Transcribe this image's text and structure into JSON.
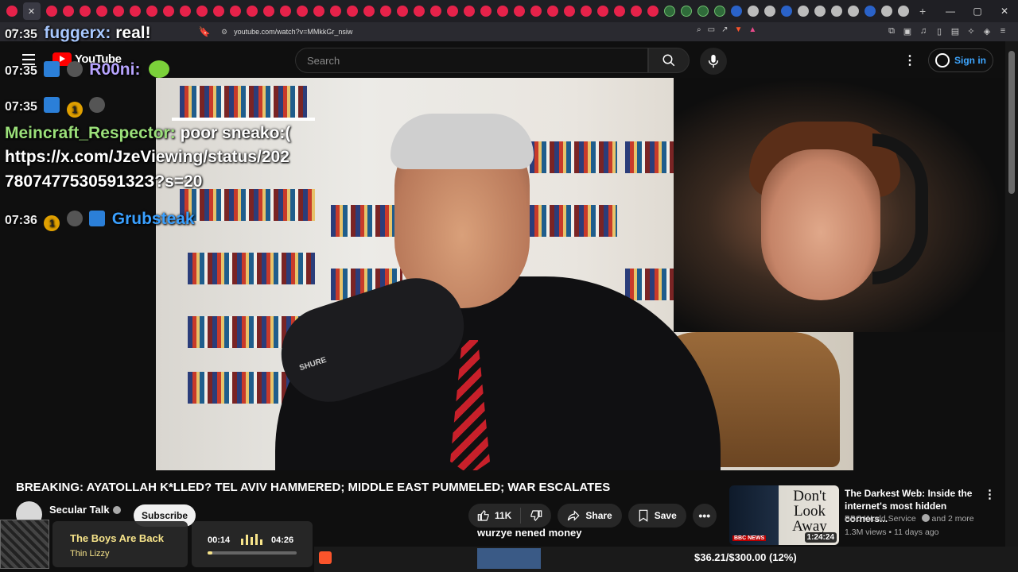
{
  "browser": {
    "url": "youtube.com/watch?v=MMkkGr_nsiw"
  },
  "youtube": {
    "logo_text": "YouTube",
    "search_placeholder": "Search",
    "signin_label": "Sign in"
  },
  "chat": [
    {
      "time": "07:35",
      "user": "fuggerx",
      "user_color": "#a8c8ff",
      "message": "real!"
    },
    {
      "time": "07:35",
      "user": "R00ni:",
      "user_color": "#b7a4ff",
      "message": ""
    },
    {
      "time": "07:35",
      "user": "",
      "user_color": "#fff",
      "message": ""
    },
    {
      "time": "",
      "user": "Meincraft_Respector",
      "user_color": "#9be07a",
      "message": "poor sneako:("
    },
    {
      "time": "",
      "user": "",
      "user_color": "#fff",
      "message": "https://x.com/JzeViewing/status/202"
    },
    {
      "time": "",
      "user": "",
      "user_color": "#fff",
      "message": "780747753059132З?s=20"
    },
    {
      "time": "07:36",
      "user": "Grubsteak",
      "user_color": "#3aa0ff",
      "message": ""
    }
  ],
  "video": {
    "title": "BREAKING: AYATOLLAH K*LLED? TEL AVIV HAMMERED; MIDDLE EAST PUMMELED; WAR ESCALATES",
    "mic_brand": "SHURE",
    "channel": "Secular Talk",
    "subscribe_label": "Subscribe",
    "likes": "11K",
    "share_label": "Share",
    "save_label": "Save"
  },
  "recommendation": {
    "thumb_text": "Don't Look Away",
    "thumb_badge": "BBC NEWS",
    "duration": "1:24:24",
    "title": "The Darkest Web: Inside the internet's most hidden corners...",
    "channel": "BBC World Service",
    "channel_extra": "and 2 more",
    "meta": "1.3M views • 11 days ago"
  },
  "overlay_message": "wurzye nened money",
  "music": {
    "title": "The Boys Are Back",
    "artist": "Thin Lizzy",
    "current": "00:14",
    "duration": "04:26",
    "progress": 0.053
  },
  "goal": {
    "text": "$36.21/$300.00 (12%)"
  },
  "colors": {
    "accent": "#3ea6ff",
    "yt_red": "#ff0000",
    "music_yellow": "#f7e48a"
  }
}
